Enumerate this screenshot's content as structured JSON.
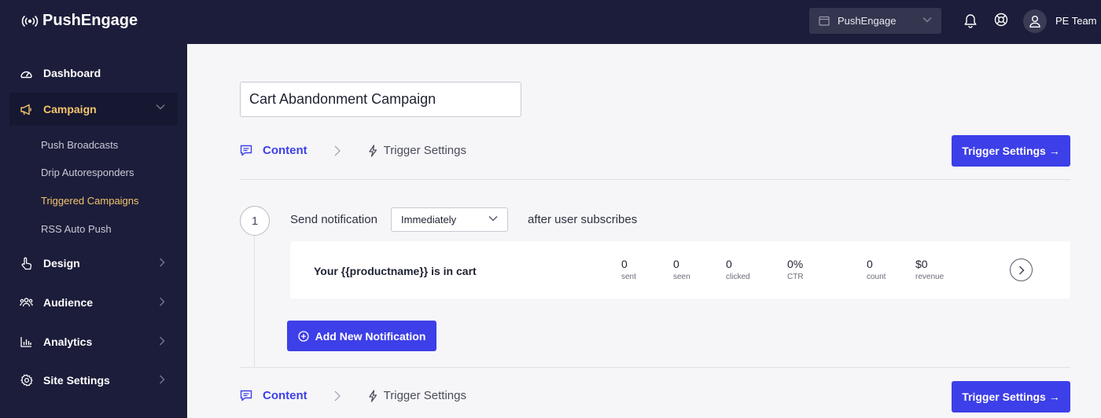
{
  "brand": {
    "name": "PushEngage"
  },
  "header": {
    "site_selector": "PushEngage",
    "user": "PE Team"
  },
  "sidebar": {
    "items": [
      {
        "label": "Dashboard"
      },
      {
        "label": "Campaign"
      },
      {
        "label": "Design"
      },
      {
        "label": "Audience"
      },
      {
        "label": "Analytics"
      },
      {
        "label": "Site Settings"
      }
    ],
    "campaign_sub": [
      {
        "label": "Push Broadcasts"
      },
      {
        "label": "Drip Autoresponders"
      },
      {
        "label": "Triggered Campaigns"
      },
      {
        "label": "RSS Auto Push"
      }
    ]
  },
  "main": {
    "campaign_name": "Cart Abandonment Campaign",
    "steps": {
      "content": "Content",
      "trigger": "Trigger Settings"
    },
    "next_button": "Trigger Settings →",
    "sequence": {
      "number": "1",
      "send_label": "Send notification",
      "delay": "Immediately",
      "after_label": "after user subscribes"
    },
    "notification": {
      "title": "Your {{productname}} is in cart",
      "stats": [
        {
          "value": "0",
          "label": "sent"
        },
        {
          "value": "0",
          "label": "seen"
        },
        {
          "value": "0",
          "label": "clicked"
        },
        {
          "value": "0%",
          "label": "CTR"
        },
        {
          "value": "0",
          "label": "count"
        },
        {
          "value": "$0",
          "label": "revenue"
        }
      ]
    },
    "add_button": "Add New Notification"
  },
  "colors": {
    "accent": "#3d3fe8",
    "sidebar": "#1c1d3a",
    "active_nav": "#f2c46d"
  }
}
